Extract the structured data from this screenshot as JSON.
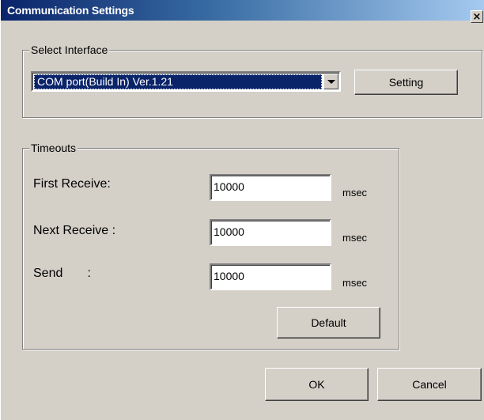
{
  "window": {
    "title": "Communication Settings",
    "close_glyph": "×"
  },
  "select_interface": {
    "group_title": "Select Interface",
    "selected_value": "COM port(Build In) Ver.1.21",
    "setting_label": "Setting"
  },
  "timeouts": {
    "group_title": "Timeouts",
    "rows": [
      {
        "label": "First Receive:",
        "value": "10000",
        "unit": "msec"
      },
      {
        "label": "Next Receive :",
        "value": "10000",
        "unit": "msec"
      },
      {
        "label": "Send       :",
        "value": "10000",
        "unit": "msec"
      }
    ],
    "default_label": "Default"
  },
  "footer": {
    "ok_label": "OK",
    "cancel_label": "Cancel"
  },
  "colors": {
    "face": "#d4d0c8",
    "title_start": "#0a246a",
    "title_end": "#a6caf0",
    "selection": "#0a246a"
  }
}
